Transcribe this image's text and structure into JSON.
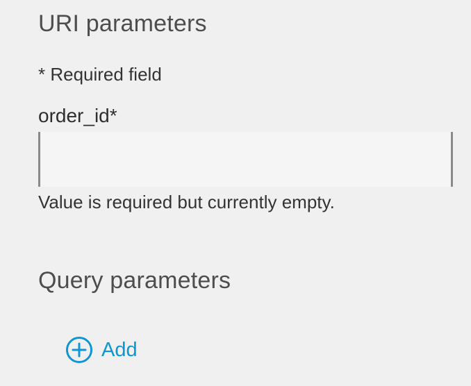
{
  "uri_section": {
    "heading": "URI parameters",
    "required_note": "* Required field",
    "field": {
      "label": "order_id*",
      "value": "",
      "error": "Value is required but currently empty."
    }
  },
  "query_section": {
    "heading": "Query parameters",
    "add_label": "Add",
    "add_icon": "plus-circle-icon"
  },
  "colors": {
    "background": "#f0f0f0",
    "accent": "#0d96d6",
    "heading": "#4d4d4d",
    "input_border": "#8a8a8a"
  }
}
